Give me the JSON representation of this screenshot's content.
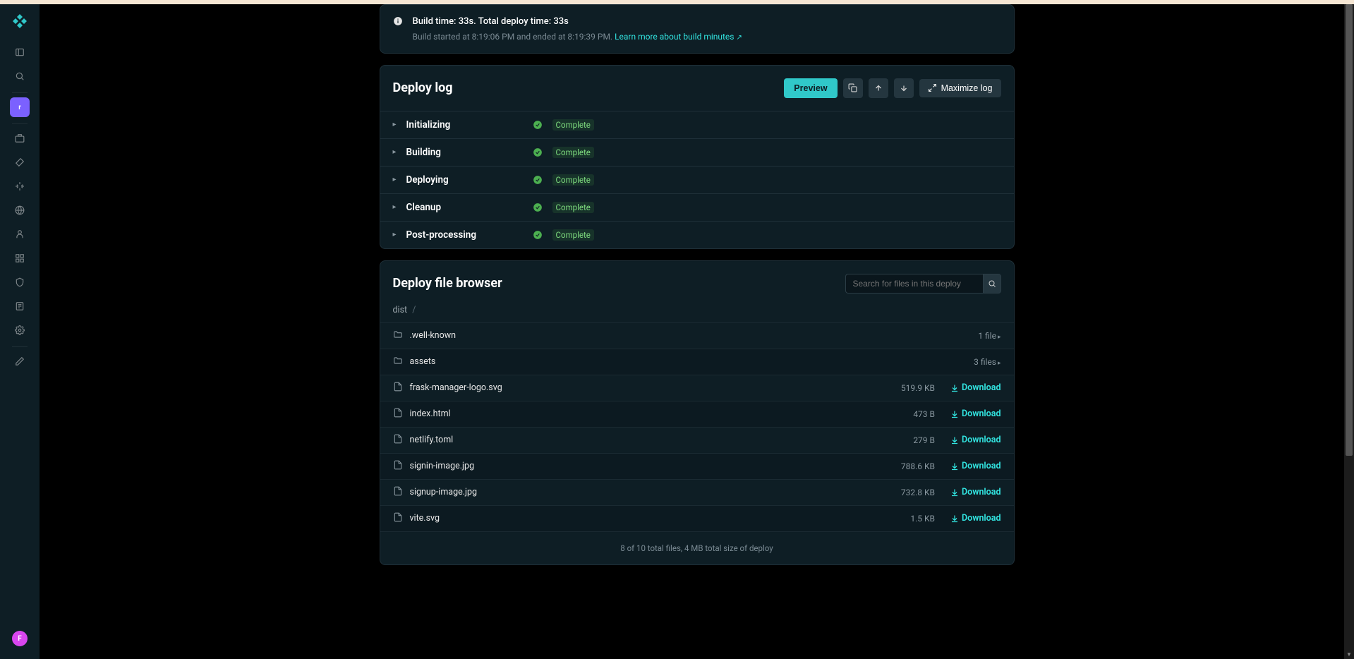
{
  "sidebar": {
    "active_badge": "r",
    "avatar_letter": "F"
  },
  "info_card": {
    "title": "Build time: 33s. Total deploy time: 33s",
    "subtitle_prefix": "Build started at 8:19:06 PM and ended at 8:19:39 PM.",
    "link_text": "Learn more about build minutes"
  },
  "deploy_log": {
    "title": "Deploy log",
    "preview_label": "Preview",
    "maximize_label": "Maximize log",
    "stages": [
      {
        "name": "Initializing",
        "status": "Complete"
      },
      {
        "name": "Building",
        "status": "Complete"
      },
      {
        "name": "Deploying",
        "status": "Complete"
      },
      {
        "name": "Cleanup",
        "status": "Complete"
      },
      {
        "name": "Post-processing",
        "status": "Complete"
      }
    ]
  },
  "file_browser": {
    "title": "Deploy file browser",
    "search_placeholder": "Search for files in this deploy",
    "breadcrumb_root": "dist",
    "breadcrumb_sep": "/",
    "folders": [
      {
        "name": ".well-known",
        "count": "1 file"
      },
      {
        "name": "assets",
        "count": "3 files"
      }
    ],
    "files": [
      {
        "name": "frask-manager-logo.svg",
        "size": "519.9 KB"
      },
      {
        "name": "index.html",
        "size": "473 B"
      },
      {
        "name": "netlify.toml",
        "size": "279 B"
      },
      {
        "name": "signin-image.jpg",
        "size": "788.6 KB"
      },
      {
        "name": "signup-image.jpg",
        "size": "732.8 KB"
      },
      {
        "name": "vite.svg",
        "size": "1.5 KB"
      }
    ],
    "download_label": "Download",
    "summary": "8 of 10 total files, 4 MB total size of deploy"
  }
}
